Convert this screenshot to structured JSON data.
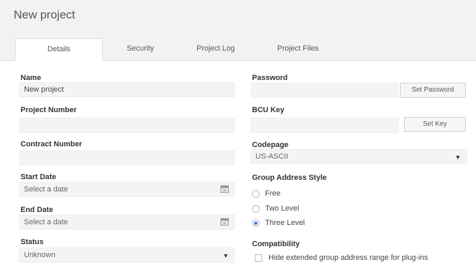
{
  "window": {
    "title": "New project"
  },
  "tabs": [
    {
      "label": "Details"
    },
    {
      "label": "Security"
    },
    {
      "label": "Project Log"
    },
    {
      "label": "Project Files"
    }
  ],
  "left": {
    "name": {
      "label": "Name",
      "value": "New project"
    },
    "project_number": {
      "label": "Project Number",
      "value": ""
    },
    "contract_number": {
      "label": "Contract Number",
      "value": ""
    },
    "start_date": {
      "label": "Start Date",
      "placeholder": "Select a date"
    },
    "end_date": {
      "label": "End Date",
      "placeholder": "Select a date"
    },
    "status": {
      "label": "Status",
      "value": "Unknown"
    }
  },
  "right": {
    "password": {
      "label": "Password",
      "value": "",
      "button": "Set Password"
    },
    "bcu_key": {
      "label": "BCU Key",
      "value": "",
      "button": "Set Key"
    },
    "codepage": {
      "label": "Codepage",
      "value": "US-ASCII"
    },
    "group_address_style": {
      "label": "Group Address Style",
      "options": [
        "Free",
        "Two Level",
        "Three Level"
      ],
      "selected": "Three Level"
    },
    "compatibility": {
      "label": "Compatibility",
      "checkbox_label": "Hide extended group address range for plug-ins",
      "checked": false
    }
  },
  "icons": {
    "calendar": "calendar-icon",
    "dropdown": "chevron-down-icon"
  },
  "colors": {
    "accent": "#3a7bd5",
    "header_bg": "#f2f2f2",
    "field_bg": "#f4f4f4"
  }
}
